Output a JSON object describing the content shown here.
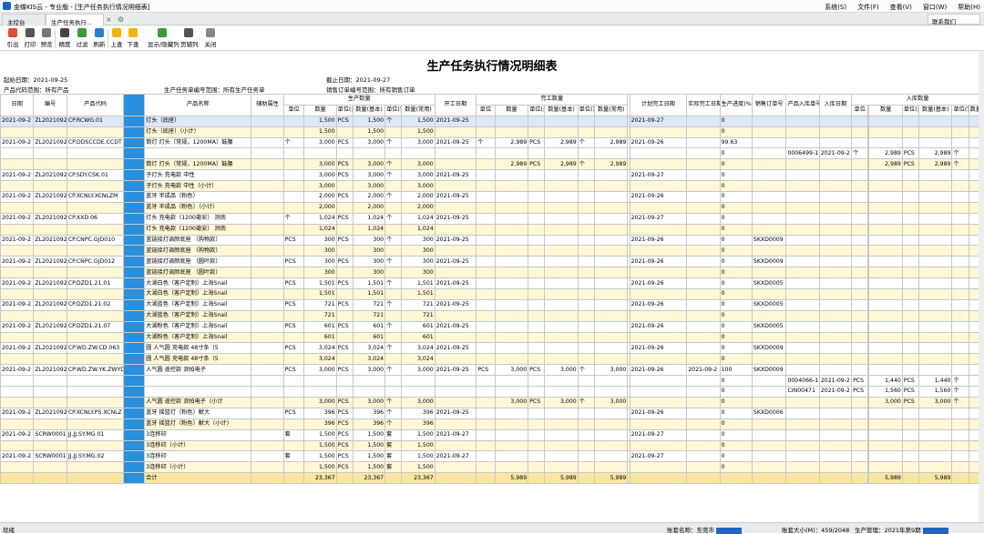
{
  "app": {
    "title": "金蝶KIS云 - 专业版 - [生产任务执行情况明细表]",
    "menu": [
      "系统(S)",
      "文件(F)",
      "查看(V)",
      "窗口(W)",
      "帮助(H)"
    ],
    "contact": "联系我们"
  },
  "tabs": [
    "主控台",
    "生产任务执行..."
  ],
  "toolbar": [
    "引出",
    "打印",
    "预览",
    "精度",
    "过滤",
    "刷新",
    "上查",
    "下查",
    "显示/隐藏列",
    "页辅列",
    "关闭"
  ],
  "report": {
    "title": "生产任务执行情况明细表",
    "start_date": "起始日期：2021-09-25",
    "end_date": "截止日期：2021-09-27",
    "product_code_range": "产品代码范围：所有产品",
    "task_no_range": "生产任务单编号范围：所有生产任务单",
    "order_no_range": "销售订单编号范围：所有销售订单"
  },
  "headers": {
    "top": [
      "日期",
      "编号",
      "产品代码",
      "",
      "产品名称",
      "辅助属性",
      "生产数量",
      "开工日期",
      "完工数量",
      "计划完工日期",
      "实际完工日期",
      "生产进度(%)",
      "销售订单号",
      "产品入库单号",
      "入库日期",
      "入库数量"
    ],
    "sub": [
      "单位",
      "数量",
      "单位(基本)",
      "数量(基本)",
      "单位(常用)",
      "数量(常用)",
      "单位",
      "数量",
      "单位(基本)",
      "数量(基本)",
      "单位(常用)",
      "数量(常用)",
      "单位",
      "数量",
      "单位(基本)",
      "数量(基本)",
      "单位(常用)",
      "数量(常"
    ]
  },
  "rows": [
    [
      "sel",
      "2021-09-2",
      "ZL2021092",
      "CP.RCWG.01",
      "灯头（底座）",
      "",
      "",
      "1,500",
      "PCS",
      "1,500",
      "个",
      "1,500",
      "2021-09-25",
      "",
      "",
      "",
      "",
      "",
      "",
      "",
      "2021-09-27",
      "",
      "0",
      "",
      "",
      "",
      "",
      "",
      "",
      "",
      "",
      "",
      ""
    ],
    [
      "sub",
      "",
      "",
      "",
      "灯头（底座）（小计）",
      "",
      "",
      "1,500",
      "",
      "1,500",
      "",
      "1,500",
      "",
      "",
      "",
      "",
      "",
      "",
      "",
      "",
      "",
      "",
      "0",
      "",
      "",
      "",
      "",
      "",
      "",
      "",
      "",
      "",
      ""
    ],
    [
      "",
      "2021-09-2",
      "ZL2021092",
      "CP.DDSCCDE.CCDT",
      "筒灯 灯头（常规，1200MA）鼓腰",
      "",
      "个",
      "3,000",
      "PCS",
      "3,000",
      "个",
      "3,000",
      "2021-09-25",
      "个",
      "2,989",
      "PCS",
      "2,989",
      "个",
      "2,989",
      "",
      "2021-09-26",
      "",
      "99.63",
      "",
      "",
      "",
      "",
      "",
      "",
      "",
      "",
      "",
      ""
    ],
    [
      "",
      "",
      "",
      "",
      "",
      "",
      "",
      "",
      "",
      "",
      "",
      "",
      "",
      "",
      "",
      "",
      "",
      "",
      "",
      "",
      "",
      "",
      "0",
      "",
      "0006499-1",
      "2021-09-2",
      "个",
      "",
      "2,989",
      "PCS",
      "2,989",
      "个",
      ""
    ],
    [
      "sub",
      "",
      "",
      "",
      "筒灯 灯头（常规，1200MA）鼓腰",
      "",
      "",
      "3,000",
      "PCS",
      "3,000",
      "个",
      "3,000",
      "",
      "",
      "2,989",
      "PCS",
      "2,989",
      "个",
      "2,989",
      "",
      "",
      "",
      "0",
      "",
      "",
      "",
      "",
      "",
      "2,989",
      "PCS",
      "2,989",
      "个",
      ""
    ],
    [
      "",
      "2021-09-2",
      "ZL2021092",
      "CP.SDY.CSK.01",
      "子灯头  充电款 中性",
      "",
      "",
      "3,000",
      "PCS",
      "3,000",
      "个",
      "3,000",
      "2021-09-25",
      "",
      "",
      "",
      "",
      "",
      "",
      "",
      "2021-09-27",
      "",
      "0",
      "",
      "",
      "",
      "",
      "",
      "",
      "",
      "",
      "",
      ""
    ],
    [
      "sub",
      "",
      "",
      "",
      "子灯头  充电款 中性（小计）",
      "",
      "",
      "3,000",
      "",
      "3,000",
      "",
      "3,000",
      "",
      "",
      "",
      "",
      "",
      "",
      "",
      "",
      "",
      "",
      "0",
      "",
      "",
      "",
      "",
      "",
      "",
      "",
      "",
      "",
      ""
    ],
    [
      "",
      "2021-09-2",
      "ZL2021092",
      "CP.XCNLY.XCNLZM",
      "蓝牙 半成品（粉色）",
      "",
      "",
      "2,000",
      "PCS",
      "2,000",
      "个",
      "2,000",
      "2021-09-25",
      "",
      "",
      "",
      "",
      "",
      "",
      "",
      "2021-09-26",
      "",
      "0",
      "",
      "",
      "",
      "",
      "",
      "",
      "",
      "",
      "",
      ""
    ],
    [
      "sub",
      "",
      "",
      "",
      "蓝牙 半成品（粉色）（小计）",
      "",
      "",
      "2,000",
      "",
      "2,000",
      "",
      "2,000",
      "",
      "",
      "",
      "",
      "",
      "",
      "",
      "",
      "",
      "",
      "0",
      "",
      "",
      "",
      "",
      "",
      "",
      "",
      "",
      "",
      ""
    ],
    [
      "",
      "2021-09-2",
      "ZL2021092",
      "CP.XXD.06",
      "灯头  充电款（1200毫安） 测南",
      "",
      "个",
      "1,024",
      "PCS",
      "1,024",
      "个",
      "1,024",
      "2021-09-25",
      "",
      "",
      "",
      "",
      "",
      "",
      "",
      "2021-09-27",
      "",
      "0",
      "",
      "",
      "",
      "",
      "",
      "",
      "",
      "",
      "",
      ""
    ],
    [
      "sub",
      "",
      "",
      "",
      "灯头  充电款（1200毫安） 测南",
      "",
      "",
      "1,024",
      "",
      "1,024",
      "",
      "1,024",
      "",
      "",
      "",
      "",
      "",
      "",
      "",
      "",
      "",
      "",
      "0",
      "",
      "",
      "",
      "",
      "",
      "",
      "",
      "",
      "",
      ""
    ],
    [
      "",
      "2021-09-2",
      "ZL2021092",
      "CP.CNPC.GJD010",
      "蓝链接灯调颜底座  （购物款）",
      "",
      "PCS",
      "300",
      "PCS",
      "300",
      "个",
      "300",
      "2021-09-25",
      "",
      "",
      "",
      "",
      "",
      "",
      "",
      "2021-09-26",
      "",
      "0",
      "SKXD0009",
      "",
      "",
      "",
      "",
      "",
      "",
      "",
      "",
      ""
    ],
    [
      "sub",
      "",
      "",
      "",
      "蓝链接灯调颜底座  （购物款）",
      "",
      "",
      "300",
      "",
      "300",
      "",
      "300",
      "",
      "",
      "",
      "",
      "",
      "",
      "",
      "",
      "",
      "",
      "0",
      "",
      "",
      "",
      "",
      "",
      "",
      "",
      "",
      "",
      ""
    ],
    [
      "",
      "2021-09-2",
      "ZL2021092",
      "CP.CNPC.GJD012",
      "蓝链接灯调颜底座  （圆叶款）",
      "",
      "PCS",
      "300",
      "PCS",
      "300",
      "个",
      "300",
      "2021-09-25",
      "",
      "",
      "",
      "",
      "",
      "",
      "",
      "2021-09-26",
      "",
      "0",
      "SKXD0009",
      "",
      "",
      "",
      "",
      "",
      "",
      "",
      "",
      ""
    ],
    [
      "sub",
      "",
      "",
      "",
      "蓝链接灯调颜底座  （圆叶款）",
      "",
      "",
      "300",
      "",
      "300",
      "",
      "300",
      "",
      "",
      "",
      "",
      "",
      "",
      "",
      "",
      "",
      "",
      "0",
      "",
      "",
      "",
      "",
      "",
      "",
      "",
      "",
      "",
      ""
    ],
    [
      "",
      "2021-09-2",
      "ZL2021092",
      "CP.DZD1.21.01",
      "大湖白色（客户定制）上海Snail",
      "",
      "PCS",
      "1,501",
      "PCS",
      "1,501",
      "个",
      "1,501",
      "2021-09-25",
      "",
      "",
      "",
      "",
      "",
      "",
      "",
      "2021-09-26",
      "",
      "0",
      "SKXD0005",
      "",
      "",
      "",
      "",
      "",
      "",
      "",
      "",
      ""
    ],
    [
      "sub",
      "",
      "",
      "",
      "大湖白色（客户定制）上海Snail",
      "",
      "",
      "1,501",
      "",
      "1,501",
      "",
      "1,501",
      "",
      "",
      "",
      "",
      "",
      "",
      "",
      "",
      "",
      "",
      "0",
      "",
      "",
      "",
      "",
      "",
      "",
      "",
      "",
      "",
      ""
    ],
    [
      "",
      "2021-09-2",
      "ZL2021092",
      "CP.DZD1.21.02",
      "大湖蓝色（客户定制）上海Snail",
      "",
      "PCS",
      "721",
      "PCS",
      "721",
      "个",
      "721",
      "2021-09-25",
      "",
      "",
      "",
      "",
      "",
      "",
      "",
      "2021-09-26",
      "",
      "0",
      "SKXD0005",
      "",
      "",
      "",
      "",
      "",
      "",
      "",
      "",
      ""
    ],
    [
      "sub",
      "",
      "",
      "",
      "大湖蓝色（客户定制）上海Snail",
      "",
      "",
      "721",
      "",
      "721",
      "",
      "721",
      "",
      "",
      "",
      "",
      "",
      "",
      "",
      "",
      "",
      "",
      "0",
      "",
      "",
      "",
      "",
      "",
      "",
      "",
      "",
      "",
      ""
    ],
    [
      "",
      "2021-09-2",
      "ZL2021092",
      "CP.DZD1.21.07",
      "大湖粉色（客户定制）上海Snail",
      "",
      "PCS",
      "601",
      "PCS",
      "601",
      "个",
      "601",
      "2021-09-25",
      "",
      "",
      "",
      "",
      "",
      "",
      "",
      "2021-09-26",
      "",
      "0",
      "SKXD0005",
      "",
      "",
      "",
      "",
      "",
      "",
      "",
      "",
      ""
    ],
    [
      "sub",
      "",
      "",
      "",
      "大湖粉色（客户定制）上海Snail",
      "",
      "",
      "601",
      "",
      "601",
      "",
      "601",
      "",
      "",
      "",
      "",
      "",
      "",
      "",
      "",
      "",
      "",
      "0",
      "",
      "",
      "",
      "",
      "",
      "",
      "",
      "",
      "",
      ""
    ],
    [
      "",
      "2021-09-2",
      "ZL2021092",
      "CP.WD.ZW.CD.063",
      "圆  人气圆  充电款  48寸条（5",
      "",
      "PCS",
      "3,024",
      "PCS",
      "3,024",
      "个",
      "3,024",
      "2021-09-25",
      "",
      "",
      "",
      "",
      "",
      "",
      "",
      "2021-09-26",
      "",
      "0",
      "SKXD0009",
      "",
      "",
      "",
      "",
      "",
      "",
      "",
      "",
      ""
    ],
    [
      "sub",
      "",
      "",
      "",
      "圆  人气圆  充电款  48寸条（5",
      "",
      "",
      "3,024",
      "",
      "3,024",
      "",
      "3,024",
      "",
      "",
      "",
      "",
      "",
      "",
      "",
      "",
      "",
      "",
      "0",
      "",
      "",
      "",
      "",
      "",
      "",
      "",
      "",
      "",
      ""
    ],
    [
      "",
      "2021-09-2",
      "ZL2021092",
      "CP.WD.ZW.YK.ZWYD",
      "人气圆  遥控款  浪拍电子",
      "",
      "PCS",
      "3,000",
      "PCS",
      "3,000",
      "个",
      "3,000",
      "2021-09-25",
      "PCS",
      "3,000",
      "PCS",
      "3,000",
      "个",
      "3,000",
      "",
      "2021-09-26",
      "2021-09-2",
      "100",
      "SKXD0009",
      "",
      "",
      "",
      "",
      "",
      "",
      "",
      "",
      ""
    ],
    [
      "",
      "",
      "",
      "",
      "",
      "",
      "",
      "",
      "",
      "",
      "",
      "",
      "",
      "",
      "",
      "",
      "",
      "",
      "",
      "",
      "",
      "",
      "0",
      "",
      "0004066-1",
      "2021-09-2",
      "PCS",
      "",
      "1,440",
      "PCS",
      "1,440",
      "个",
      ""
    ],
    [
      "",
      "",
      "",
      "",
      "",
      "",
      "",
      "",
      "",
      "",
      "",
      "",
      "",
      "",
      "",
      "",
      "",
      "",
      "",
      "",
      "",
      "",
      "0",
      "",
      "CIN00471",
      "2021-09-2",
      "PCS",
      "",
      "1,560",
      "PCS",
      "1,560",
      "个",
      ""
    ],
    [
      "sub",
      "",
      "",
      "",
      "人气圆  遥控款  浪拍电子（小计",
      "",
      "",
      "3,000",
      "PCS",
      "3,000",
      "个",
      "3,000",
      "",
      "",
      "3,000",
      "PCS",
      "3,000",
      "个",
      "3,000",
      "",
      "",
      "",
      "0",
      "",
      "",
      "",
      "",
      "",
      "3,000",
      "PCS",
      "3,000",
      "个",
      ""
    ],
    [
      "",
      "2021-09-2",
      "ZL2021092",
      "CP.XCNLY.PS.XCNLZ",
      "蓝牙 摇篮灯（粉色）献大",
      "",
      "PCS",
      "396",
      "PCS",
      "396",
      "个",
      "396",
      "2021-09-25",
      "",
      "",
      "",
      "",
      "",
      "",
      "",
      "2021-09-26",
      "",
      "0",
      "SKXD0006",
      "",
      "",
      "",
      "",
      "",
      "",
      "",
      "",
      ""
    ],
    [
      "sub",
      "",
      "",
      "",
      "蓝牙 摇篮灯（粉色）献大（小计）",
      "",
      "",
      "396",
      "PCS",
      "396",
      "个",
      "396",
      "",
      "",
      "",
      "",
      "",
      "",
      "",
      "",
      "",
      "",
      "0",
      "",
      "",
      "",
      "",
      "",
      "",
      "",
      "",
      "",
      ""
    ],
    [
      "",
      "2021-09-2",
      "SCRW00018",
      "JJ.JJ.SY.MG.01",
      "3连移印",
      "",
      "套",
      "1,500",
      "PCS",
      "1,500",
      "套",
      "1,500",
      "2021-09-27",
      "",
      "",
      "",
      "",
      "",
      "",
      "",
      "2021-09-27",
      "",
      "0",
      "",
      "",
      "",
      "",
      "",
      "",
      "",
      "",
      "",
      ""
    ],
    [
      "sub",
      "",
      "",
      "",
      "3连移印（小计）",
      "",
      "",
      "1,500",
      "PCS",
      "1,500",
      "套",
      "1,500",
      "",
      "",
      "",
      "",
      "",
      "",
      "",
      "",
      "",
      "",
      "0",
      "",
      "",
      "",
      "",
      "",
      "",
      "",
      "",
      "",
      ""
    ],
    [
      "",
      "2021-09-2",
      "SCRW00018",
      "JJ.JJ.SY.MG.02",
      "3连移印",
      "",
      "套",
      "1,500",
      "PCS",
      "1,500",
      "套",
      "1,500",
      "2021-09-27",
      "",
      "",
      "",
      "",
      "",
      "",
      "",
      "2021-09-27",
      "",
      "0",
      "",
      "",
      "",
      "",
      "",
      "",
      "",
      "",
      "",
      ""
    ],
    [
      "sub",
      "",
      "",
      "",
      "3连移印（小计）",
      "",
      "",
      "1,500",
      "PCS",
      "1,500",
      "套",
      "1,500",
      "",
      "",
      "",
      "",
      "",
      "",
      "",
      "",
      "",
      "",
      "0",
      "",
      "",
      "",
      "",
      "",
      "",
      "",
      "",
      "",
      ""
    ],
    [
      "tot",
      "",
      "",
      "",
      "合计",
      "",
      "",
      "23,367",
      "",
      "23,367",
      "",
      "23,367",
      "",
      "",
      "5,989",
      "",
      "5,989",
      "",
      "5,989",
      "",
      "",
      "",
      "",
      "",
      "",
      "",
      "",
      "",
      "5,989",
      "",
      "5,989",
      "",
      ""
    ]
  ],
  "status": {
    "left": "就绪",
    "account": "账套名称：东莞市",
    "db": "账套大小(M)：459/2048",
    "period": "生产管理：2021年第9期"
  }
}
